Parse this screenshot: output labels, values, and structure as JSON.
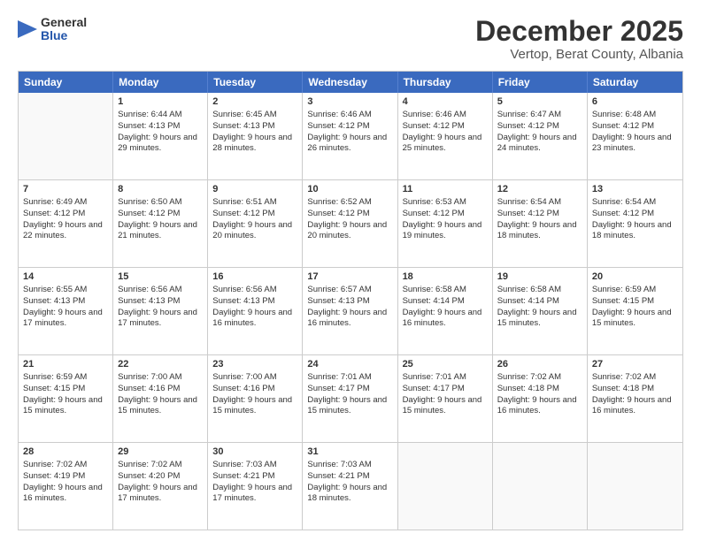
{
  "logo": {
    "general": "General",
    "blue": "Blue"
  },
  "title": {
    "month": "December 2025",
    "location": "Vertop, Berat County, Albania"
  },
  "header_days": [
    "Sunday",
    "Monday",
    "Tuesday",
    "Wednesday",
    "Thursday",
    "Friday",
    "Saturday"
  ],
  "weeks": [
    [
      {
        "day": "",
        "sunrise": "",
        "sunset": "",
        "daylight": ""
      },
      {
        "day": "1",
        "sunrise": "Sunrise: 6:44 AM",
        "sunset": "Sunset: 4:13 PM",
        "daylight": "Daylight: 9 hours and 29 minutes."
      },
      {
        "day": "2",
        "sunrise": "Sunrise: 6:45 AM",
        "sunset": "Sunset: 4:13 PM",
        "daylight": "Daylight: 9 hours and 28 minutes."
      },
      {
        "day": "3",
        "sunrise": "Sunrise: 6:46 AM",
        "sunset": "Sunset: 4:12 PM",
        "daylight": "Daylight: 9 hours and 26 minutes."
      },
      {
        "day": "4",
        "sunrise": "Sunrise: 6:46 AM",
        "sunset": "Sunset: 4:12 PM",
        "daylight": "Daylight: 9 hours and 25 minutes."
      },
      {
        "day": "5",
        "sunrise": "Sunrise: 6:47 AM",
        "sunset": "Sunset: 4:12 PM",
        "daylight": "Daylight: 9 hours and 24 minutes."
      },
      {
        "day": "6",
        "sunrise": "Sunrise: 6:48 AM",
        "sunset": "Sunset: 4:12 PM",
        "daylight": "Daylight: 9 hours and 23 minutes."
      }
    ],
    [
      {
        "day": "7",
        "sunrise": "Sunrise: 6:49 AM",
        "sunset": "Sunset: 4:12 PM",
        "daylight": "Daylight: 9 hours and 22 minutes."
      },
      {
        "day": "8",
        "sunrise": "Sunrise: 6:50 AM",
        "sunset": "Sunset: 4:12 PM",
        "daylight": "Daylight: 9 hours and 21 minutes."
      },
      {
        "day": "9",
        "sunrise": "Sunrise: 6:51 AM",
        "sunset": "Sunset: 4:12 PM",
        "daylight": "Daylight: 9 hours and 20 minutes."
      },
      {
        "day": "10",
        "sunrise": "Sunrise: 6:52 AM",
        "sunset": "Sunset: 4:12 PM",
        "daylight": "Daylight: 9 hours and 20 minutes."
      },
      {
        "day": "11",
        "sunrise": "Sunrise: 6:53 AM",
        "sunset": "Sunset: 4:12 PM",
        "daylight": "Daylight: 9 hours and 19 minutes."
      },
      {
        "day": "12",
        "sunrise": "Sunrise: 6:54 AM",
        "sunset": "Sunset: 4:12 PM",
        "daylight": "Daylight: 9 hours and 18 minutes."
      },
      {
        "day": "13",
        "sunrise": "Sunrise: 6:54 AM",
        "sunset": "Sunset: 4:12 PM",
        "daylight": "Daylight: 9 hours and 18 minutes."
      }
    ],
    [
      {
        "day": "14",
        "sunrise": "Sunrise: 6:55 AM",
        "sunset": "Sunset: 4:13 PM",
        "daylight": "Daylight: 9 hours and 17 minutes."
      },
      {
        "day": "15",
        "sunrise": "Sunrise: 6:56 AM",
        "sunset": "Sunset: 4:13 PM",
        "daylight": "Daylight: 9 hours and 17 minutes."
      },
      {
        "day": "16",
        "sunrise": "Sunrise: 6:56 AM",
        "sunset": "Sunset: 4:13 PM",
        "daylight": "Daylight: 9 hours and 16 minutes."
      },
      {
        "day": "17",
        "sunrise": "Sunrise: 6:57 AM",
        "sunset": "Sunset: 4:13 PM",
        "daylight": "Daylight: 9 hours and 16 minutes."
      },
      {
        "day": "18",
        "sunrise": "Sunrise: 6:58 AM",
        "sunset": "Sunset: 4:14 PM",
        "daylight": "Daylight: 9 hours and 16 minutes."
      },
      {
        "day": "19",
        "sunrise": "Sunrise: 6:58 AM",
        "sunset": "Sunset: 4:14 PM",
        "daylight": "Daylight: 9 hours and 15 minutes."
      },
      {
        "day": "20",
        "sunrise": "Sunrise: 6:59 AM",
        "sunset": "Sunset: 4:15 PM",
        "daylight": "Daylight: 9 hours and 15 minutes."
      }
    ],
    [
      {
        "day": "21",
        "sunrise": "Sunrise: 6:59 AM",
        "sunset": "Sunset: 4:15 PM",
        "daylight": "Daylight: 9 hours and 15 minutes."
      },
      {
        "day": "22",
        "sunrise": "Sunrise: 7:00 AM",
        "sunset": "Sunset: 4:16 PM",
        "daylight": "Daylight: 9 hours and 15 minutes."
      },
      {
        "day": "23",
        "sunrise": "Sunrise: 7:00 AM",
        "sunset": "Sunset: 4:16 PM",
        "daylight": "Daylight: 9 hours and 15 minutes."
      },
      {
        "day": "24",
        "sunrise": "Sunrise: 7:01 AM",
        "sunset": "Sunset: 4:17 PM",
        "daylight": "Daylight: 9 hours and 15 minutes."
      },
      {
        "day": "25",
        "sunrise": "Sunrise: 7:01 AM",
        "sunset": "Sunset: 4:17 PM",
        "daylight": "Daylight: 9 hours and 15 minutes."
      },
      {
        "day": "26",
        "sunrise": "Sunrise: 7:02 AM",
        "sunset": "Sunset: 4:18 PM",
        "daylight": "Daylight: 9 hours and 16 minutes."
      },
      {
        "day": "27",
        "sunrise": "Sunrise: 7:02 AM",
        "sunset": "Sunset: 4:18 PM",
        "daylight": "Daylight: 9 hours and 16 minutes."
      }
    ],
    [
      {
        "day": "28",
        "sunrise": "Sunrise: 7:02 AM",
        "sunset": "Sunset: 4:19 PM",
        "daylight": "Daylight: 9 hours and 16 minutes."
      },
      {
        "day": "29",
        "sunrise": "Sunrise: 7:02 AM",
        "sunset": "Sunset: 4:20 PM",
        "daylight": "Daylight: 9 hours and 17 minutes."
      },
      {
        "day": "30",
        "sunrise": "Sunrise: 7:03 AM",
        "sunset": "Sunset: 4:21 PM",
        "daylight": "Daylight: 9 hours and 17 minutes."
      },
      {
        "day": "31",
        "sunrise": "Sunrise: 7:03 AM",
        "sunset": "Sunset: 4:21 PM",
        "daylight": "Daylight: 9 hours and 18 minutes."
      },
      {
        "day": "",
        "sunrise": "",
        "sunset": "",
        "daylight": ""
      },
      {
        "day": "",
        "sunrise": "",
        "sunset": "",
        "daylight": ""
      },
      {
        "day": "",
        "sunrise": "",
        "sunset": "",
        "daylight": ""
      }
    ]
  ]
}
